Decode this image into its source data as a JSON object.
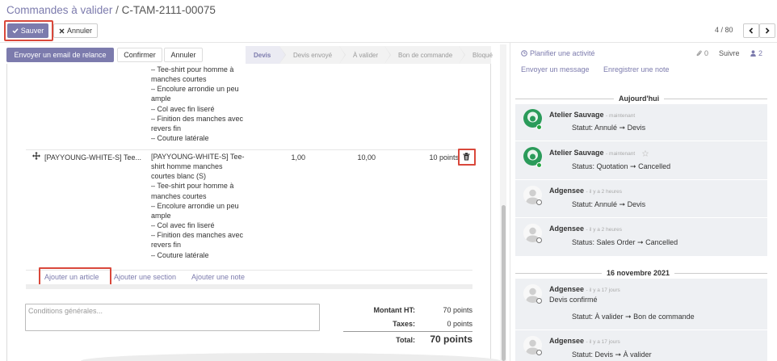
{
  "breadcrumb": {
    "parent": "Commandes à valider",
    "separator": "/",
    "current": "C-TAM-2111-00075"
  },
  "toolbar": {
    "save_label": "Sauver",
    "discard_label": "Annuler"
  },
  "pager": {
    "value": "4 / 80"
  },
  "statusbar": {
    "buttons": {
      "email": "Envoyer un email de relance",
      "confirm": "Confirmer",
      "cancel": "Annuler"
    },
    "stages": [
      "Devis",
      "Devis envoyé",
      "À valider",
      "Bon de commande",
      "Bloqué"
    ],
    "active_stage": "Devis"
  },
  "order_lines": {
    "prev_description": "– Tee-shirt pour homme à\nmanches courtes\n– Encolure arrondie un peu\nample\n– Col avec fin liseré\n– Finition des manches avec\nrevers fin\n– Couture latérale",
    "line": {
      "product": "[PAYYOUNG-WHITE-S] Tee...",
      "description": "[PAYYOUNG-WHITE-S] Tee-\nshirt homme manches\ncourtes blanc (S)\n– Tee-shirt pour homme à\nmanches courtes\n– Encolure arrondie un peu\nample\n– Col avec fin liseré\n– Finition des manches avec\nrevers fin\n– Couture latérale",
      "quantity": "1,00",
      "unit_price": "10,00",
      "subtotal": "10 points"
    },
    "add_links": {
      "article": "Ajouter un article",
      "section": "Ajouter une section",
      "note": "Ajouter une note"
    }
  },
  "terms": {
    "placeholder": "Conditions générales..."
  },
  "totals": {
    "untaxed_label": "Montant HT:",
    "untaxed_value": "70 points",
    "taxes_label": "Taxes:",
    "taxes_value": "0 points",
    "total_label": "Total:",
    "total_value": "70 points"
  },
  "chatter": {
    "plan_activity": "Planifier une activité",
    "attachments_count": "0",
    "follow": "Suivre",
    "followers_count": "2",
    "send_message": "Envoyer un message",
    "log_note": "Enregistrer une note",
    "date_separators": [
      "Aujourd'hui",
      "16 novembre 2021"
    ],
    "messages": [
      {
        "author": "Atelier Sauvage",
        "time": "maintenant",
        "tracking": "Statut: Annulé ➞ Devis"
      },
      {
        "author": "Atelier Sauvage",
        "time": "maintenant",
        "tracking": "Status: Quotation ➞ Cancelled"
      },
      {
        "author": "Adgensee",
        "time": "il y a 2 heures",
        "tracking": "Statut: Annulé ➞ Devis"
      },
      {
        "author": "Adgensee",
        "time": "il y a 2 heures",
        "tracking": "Status: Sales Order ➞ Cancelled"
      },
      {
        "author": "Adgensee",
        "time": "il y a 17 jours",
        "body": "Devis confirmé",
        "tracking": "Statut: À valider ➞ Bon de commande"
      },
      {
        "author": "Adgensee",
        "time": "il y a 17 jours",
        "tracking": "Statut: Devis ➞ À valider"
      }
    ]
  },
  "colors": {
    "primary": "#7c7bad",
    "highlight_border": "#d9483b",
    "online": "#28a745",
    "message_bg": "#eef0f3"
  },
  "icons": {
    "save": "check-icon",
    "discard": "close-icon",
    "delete": "trash-icon",
    "drag": "move-handle-icon",
    "activity": "clock-icon",
    "attachment": "paperclip-icon",
    "followers": "user-icon"
  }
}
